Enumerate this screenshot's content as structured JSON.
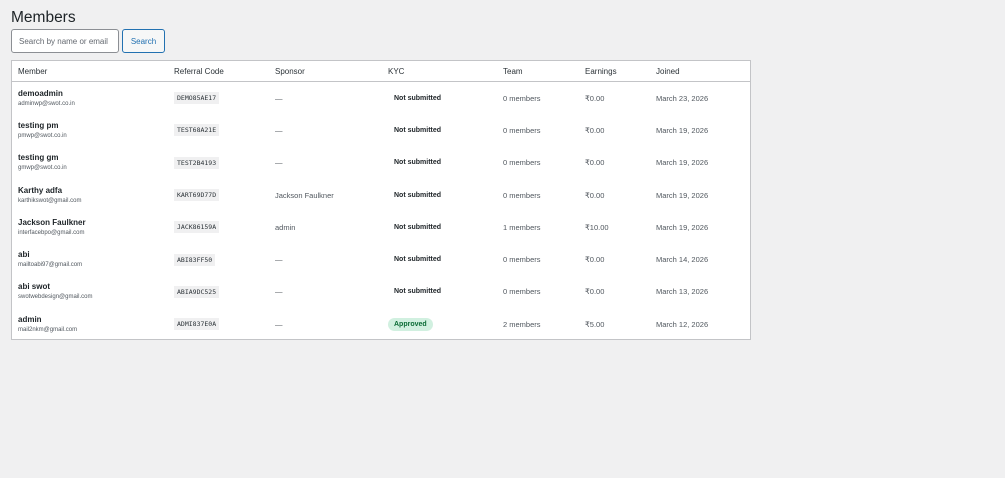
{
  "page": {
    "title": "Members"
  },
  "search": {
    "placeholder": "Search by name or email",
    "value": "",
    "button_label": "Search"
  },
  "table": {
    "headers": {
      "member": "Member",
      "referral_code": "Referral Code",
      "sponsor": "Sponsor",
      "kyc": "KYC",
      "team": "Team",
      "earnings": "Earnings",
      "joined": "Joined"
    },
    "rows": [
      {
        "name": "demoadmin",
        "email": "adminwp@swot.co.in",
        "referral_code": "DEMO85AE17",
        "sponsor": "—",
        "kyc": "Not submitted",
        "kyc_status": "none",
        "team": "0 members",
        "earnings": "₹0.00",
        "joined": "March 23, 2026"
      },
      {
        "name": "testing pm",
        "email": "pmwp@swot.co.in",
        "referral_code": "TEST68A21E",
        "sponsor": "—",
        "kyc": "Not submitted",
        "kyc_status": "none",
        "team": "0 members",
        "earnings": "₹0.00",
        "joined": "March 19, 2026"
      },
      {
        "name": "testing gm",
        "email": "gmwp@swot.co.in",
        "referral_code": "TEST2B4193",
        "sponsor": "—",
        "kyc": "Not submitted",
        "kyc_status": "none",
        "team": "0 members",
        "earnings": "₹0.00",
        "joined": "March 19, 2026"
      },
      {
        "name": "Karthy adfa",
        "email": "karthikswot@gmail.com",
        "referral_code": "KART69D77D",
        "sponsor": "Jackson Faulkner",
        "kyc": "Not submitted",
        "kyc_status": "none",
        "team": "0 members",
        "earnings": "₹0.00",
        "joined": "March 19, 2026"
      },
      {
        "name": "Jackson Faulkner",
        "email": "interfacebpo@gmail.com",
        "referral_code": "JACK86159A",
        "sponsor": "admin",
        "kyc": "Not submitted",
        "kyc_status": "none",
        "team": "1 members",
        "earnings": "₹10.00",
        "joined": "March 19, 2026"
      },
      {
        "name": "abi",
        "email": "mailtoabi97@gmail.com",
        "referral_code": "ABI83FF50",
        "sponsor": "—",
        "kyc": "Not submitted",
        "kyc_status": "none",
        "team": "0 members",
        "earnings": "₹0.00",
        "joined": "March 14, 2026"
      },
      {
        "name": "abi swot",
        "email": "swotwebdesign@gmail.com",
        "referral_code": "ABIA9DC525",
        "sponsor": "—",
        "kyc": "Not submitted",
        "kyc_status": "none",
        "team": "0 members",
        "earnings": "₹0.00",
        "joined": "March 13, 2026"
      },
      {
        "name": "admin",
        "email": "mail2nkm@gmail.com",
        "referral_code": "ADMI837E0A",
        "sponsor": "—",
        "kyc": "Approved",
        "kyc_status": "approved",
        "team": "2 members",
        "earnings": "₹5.00",
        "joined": "March 12, 2026"
      }
    ]
  },
  "colors": {
    "background": "#f0f0f1",
    "accent": "#2271b1",
    "approved_bg": "#d1f0e0",
    "approved_text": "#0a6b35"
  }
}
